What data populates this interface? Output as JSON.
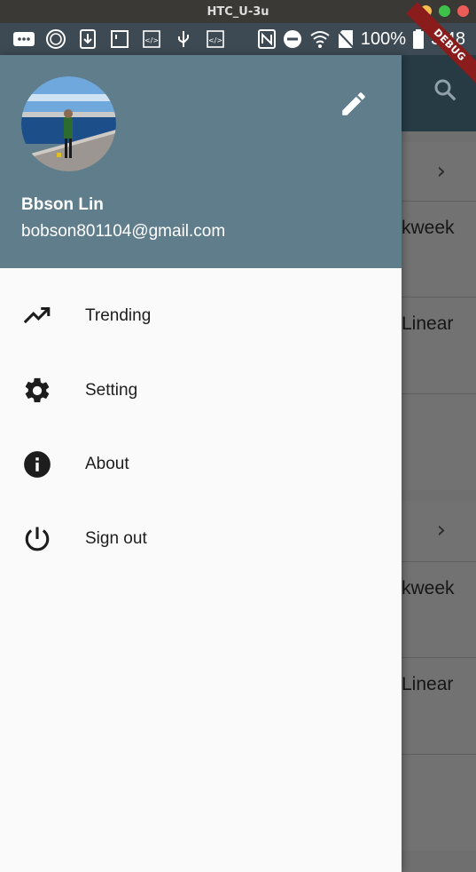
{
  "window": {
    "title": "HTC_U-3u",
    "buttons": [
      "minimize",
      "maximize",
      "close"
    ]
  },
  "status_bar": {
    "icons_left": [
      "more-icon",
      "app-icon",
      "download-icon",
      "notification-icon",
      "code-icon",
      "usb-icon",
      "code-icon"
    ],
    "icons_right": [
      "nfc-icon",
      "dnd-icon",
      "wifi-icon",
      "no-sim-icon"
    ],
    "battery": "100%",
    "time": "3:48"
  },
  "debug_banner": "DEBUG",
  "drawer": {
    "user": {
      "name": "Bbson Lin",
      "email": "bobson801104@gmail.com"
    },
    "edit_icon": "pencil-icon",
    "items": [
      {
        "label": "Trending",
        "icon": "trending-up-icon"
      },
      {
        "label": "Setting",
        "icon": "gear-icon"
      },
      {
        "label": "About",
        "icon": "info-icon"
      },
      {
        "label": "Sign out",
        "icon": "power-icon"
      }
    ]
  },
  "background_list": {
    "items": [
      {
        "text": "kweek"
      },
      {
        "text": "Linear"
      },
      {
        "text": "kweek"
      },
      {
        "text": "Linear"
      }
    ]
  },
  "colors": {
    "drawer_header": "#607d8b",
    "app_bar": "#273b44",
    "debug": "#8a1c1c"
  }
}
